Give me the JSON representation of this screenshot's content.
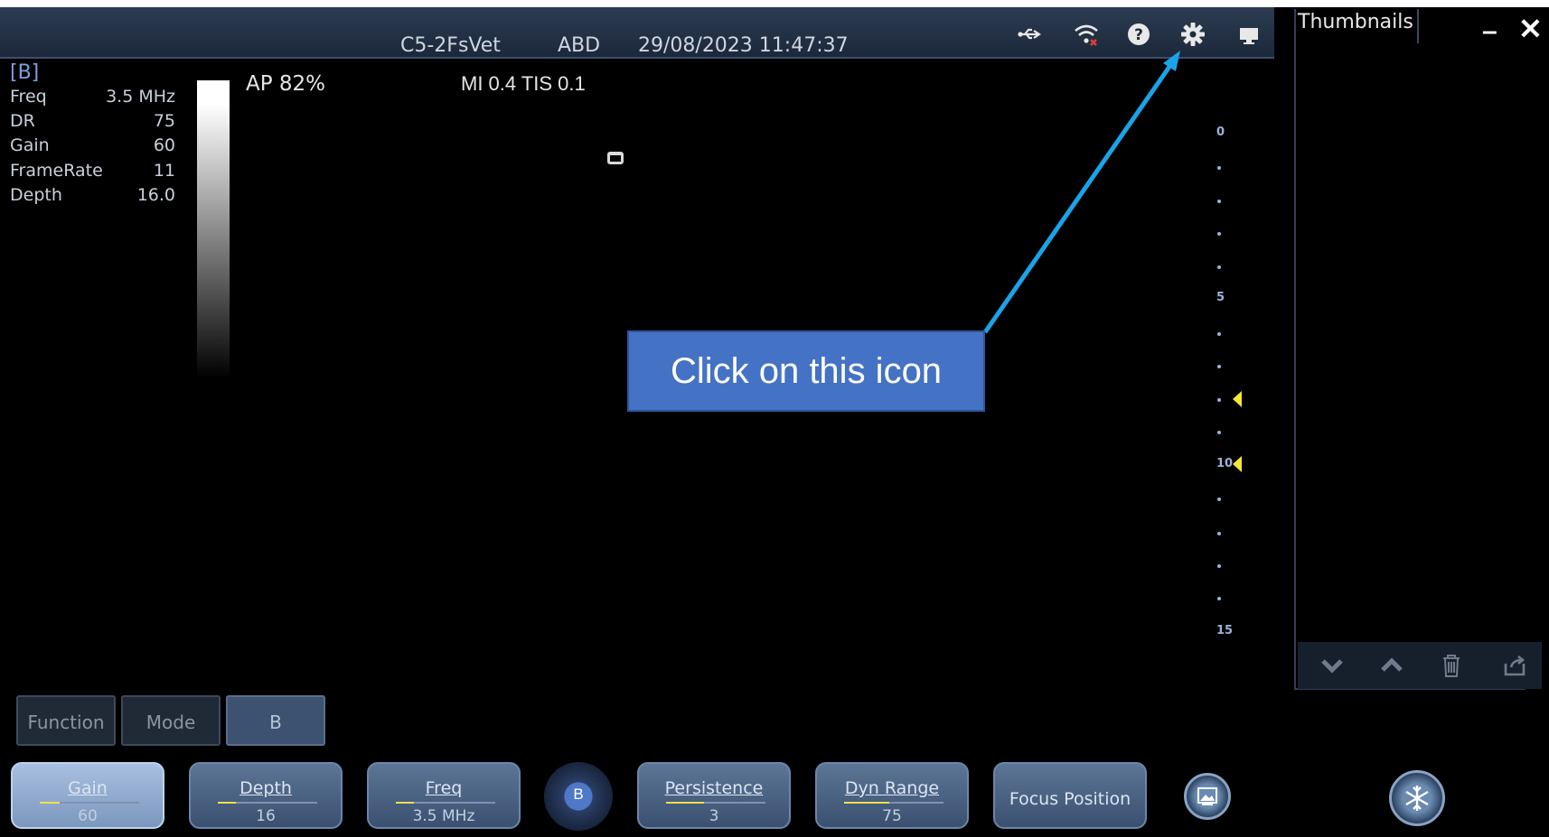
{
  "topbar": {
    "probe": "C5-2FsVet",
    "preset": "ABD",
    "datetime": "29/08/2023 11:47:37",
    "icons": [
      "usb-icon",
      "wifi-disconnected-icon",
      "help-icon",
      "settings-gear-icon",
      "display-icon"
    ]
  },
  "params": {
    "mode_tag": "[B]",
    "rows": [
      {
        "label": "Freq",
        "value": "3.5 MHz"
      },
      {
        "label": "DR",
        "value": "75"
      },
      {
        "label": "Gain",
        "value": "60"
      },
      {
        "label": "FrameRate",
        "value": "11"
      },
      {
        "label": "Depth",
        "value": "16.0"
      }
    ]
  },
  "overlay": {
    "ap": "AP  82%",
    "mi_tis": "MI 0.4 TIS 0.1"
  },
  "depth_scale": {
    "labels": [
      "0",
      "5",
      "10",
      "15"
    ]
  },
  "thumbnails": {
    "title": "Thumbnails",
    "minimize": "–",
    "close": "✕"
  },
  "mode_buttons": [
    "Function",
    "Mode",
    "B"
  ],
  "softkeys": [
    {
      "label": "Gain",
      "value": "60"
    },
    {
      "label": "Depth",
      "value": "16"
    },
    {
      "label": "Freq",
      "value": "3.5 MHz"
    },
    {
      "label": "Persistence",
      "value": "3"
    },
    {
      "label": "Dyn Range",
      "value": "75"
    },
    {
      "label": "Focus Position",
      "value": ""
    }
  ],
  "knob": {
    "label": "B"
  },
  "annotation": {
    "text": "Click on this icon"
  },
  "colors": {
    "annotation_fill": "#4472c4",
    "arrow": "#1aa3e8",
    "focus_marker": "#f2e63a"
  }
}
